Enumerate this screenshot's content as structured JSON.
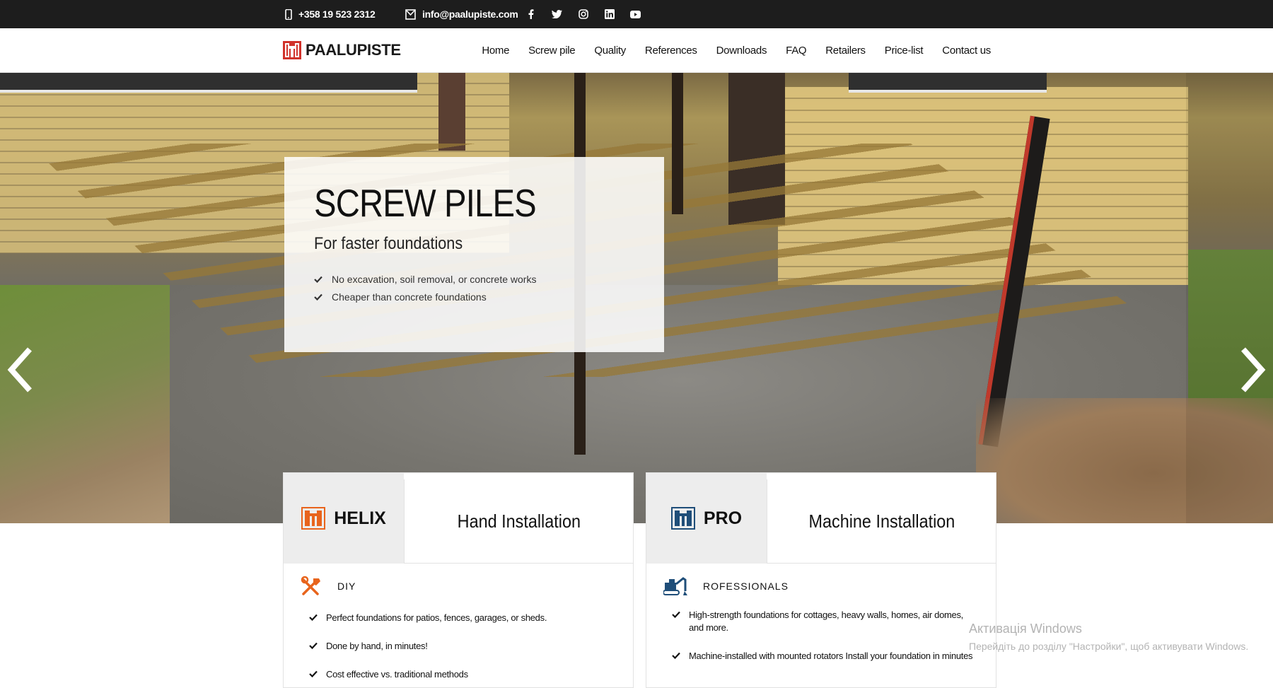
{
  "topbar": {
    "phone": "+358 19 523 2312",
    "email": "info@paalupiste.com",
    "social_icons": [
      "facebook-icon",
      "twitter-icon",
      "instagram-icon",
      "linkedin-icon",
      "youtube-icon"
    ]
  },
  "nav": {
    "logo_text": "PAALUPISTE",
    "items": [
      "Home",
      "Screw pile",
      "Quality",
      "References",
      "Downloads",
      "FAQ",
      "Retailers",
      "Price-list",
      "Contact us"
    ]
  },
  "hero": {
    "title": "SCREW PILES",
    "subtitle": "For faster foundations",
    "bullets": [
      "No excavation, soil removal, or concrete works",
      "Cheaper than concrete foundations"
    ]
  },
  "cards": [
    {
      "brand": "HELIX",
      "heading": "Hand Installation",
      "category": "DIY",
      "bullets": [
        "Perfect foundations for patios, fences, garages, or sheds.",
        "Done by hand, in minutes!",
        "Cost effective vs. traditional methods"
      ],
      "accent": "#e8641c"
    },
    {
      "brand": "PRO",
      "heading": "Machine Installation",
      "category": "ROFESSIONALS",
      "bullets": [
        "High-strength foundations for cottages, heavy walls, homes, air domes, and more.",
        "Machine-installed with mounted rotators Install your foundation in minutes"
      ],
      "accent": "#1f4e79"
    }
  ],
  "watermark": {
    "title": "Активація Windows",
    "subtitle": "Перейдіть до розділу \"Настройки\", щоб активувати Windows."
  },
  "colors": {
    "topbar_bg": "#1d1d1d",
    "logo_red": "#d1322b",
    "helix_orange": "#e8641c",
    "pro_blue": "#1f4e79"
  }
}
